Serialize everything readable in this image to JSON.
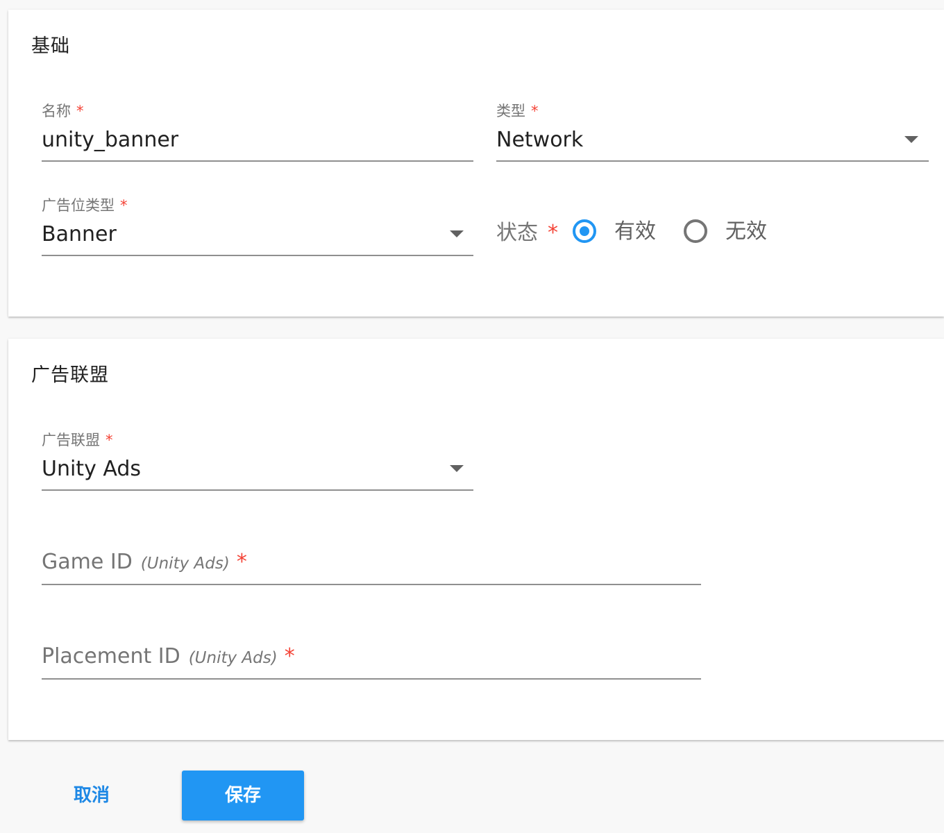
{
  "sections": {
    "basic": {
      "title": "基础",
      "name_field": {
        "label": "名称",
        "required": "*",
        "value": "unity_banner"
      },
      "type_field": {
        "label": "类型",
        "required": "*",
        "value": "Network"
      },
      "placement_type_field": {
        "label": "广告位类型",
        "required": "*",
        "value": "Banner"
      },
      "status_field": {
        "label": "状态",
        "required": "*",
        "options": [
          {
            "label": "有效",
            "checked": true
          },
          {
            "label": "无效",
            "checked": false
          }
        ]
      }
    },
    "network": {
      "title": "广告联盟",
      "network_field": {
        "label": "广告联盟",
        "required": "*",
        "value": "Unity Ads"
      },
      "game_id_field": {
        "placeholder": "Game ID",
        "hint": "(Unity Ads)",
        "required": "*",
        "value": ""
      },
      "placement_id_field": {
        "placeholder": "Placement ID",
        "hint": "(Unity Ads)",
        "required": "*",
        "value": ""
      }
    }
  },
  "actions": {
    "cancel_label": "取消",
    "save_label": "保存"
  },
  "colors": {
    "accent": "#2196f3",
    "required": "#f44336",
    "cancel_text": "#1e88e5"
  },
  "icons": {
    "dropdown": "dropdown-caret-icon",
    "radio_checked": "radio-checked-icon",
    "radio_unchecked": "radio-unchecked-icon"
  }
}
